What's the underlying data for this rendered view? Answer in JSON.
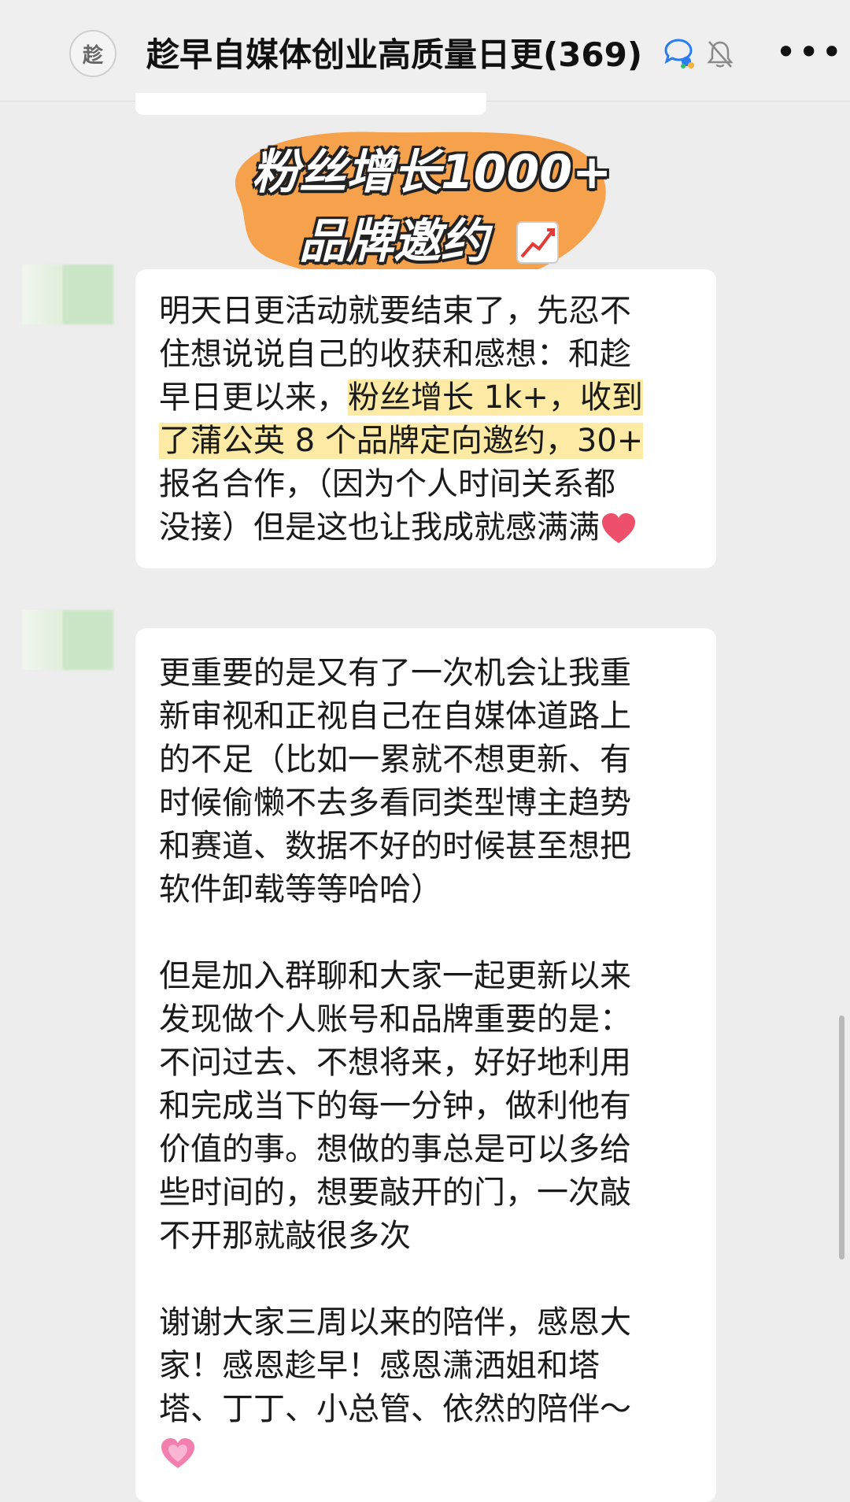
{
  "header": {
    "avatar_glyph": "趁",
    "title": "趁早自媒体创业高质量日更(369)"
  },
  "sticker": {
    "line1": "粉丝增长1000+",
    "line2": "品牌邀约"
  },
  "message1": {
    "lines": [
      "明天日更活动就要结束了，先忍不",
      "住想说说自己的收获和感想：和趁",
      "早日更以来，",
      "粉丝增长 1k+，收到",
      "了蒲公英 8 个品牌定向邀约，30+",
      "报名合作，（因为个人时间关系都",
      "没接）但是这也让我成就感满满"
    ]
  },
  "message2": {
    "lines": [
      "更重要的是又有了一次机会让我重",
      "新审视和正视自己在自媒体道路上",
      "的不足（比如一累就不想更新、有",
      "时候偷懒不去多看同类型博主趋势",
      "和赛道、数据不好的时候甚至想把",
      "软件卸载等等哈哈）",
      "但是加入群聊和大家一起更新以来",
      "发现做个人账号和品牌重要的是：",
      "不问过去、不想将来，好好地利用",
      "和完成当下的每一分钟，做利他有",
      "价值的事。想做的事总是可以多给",
      "些时间的，想要敲开的门，一次敲",
      "不开那就敲很多次",
      "谢谢大家三周以来的陪伴，感恩大",
      "家！感恩趁早！感恩潇洒姐和塔",
      "塔、丁丁、小总管、依然的陪伴～"
    ]
  },
  "colors": {
    "background": "#ededed",
    "bubble": "#ffffff",
    "highlight": "#fdeaa5",
    "sticker_orange": "#f6a14b",
    "heart_red": "#ee4f6a",
    "heart_pink": "#f27fb0"
  },
  "icons": [
    "group-avatar",
    "wecom-chat-icon",
    "mute-bell-icon",
    "more-icon",
    "chart-up-emoji",
    "red-heart-emoji",
    "pink-heart-emoji"
  ]
}
